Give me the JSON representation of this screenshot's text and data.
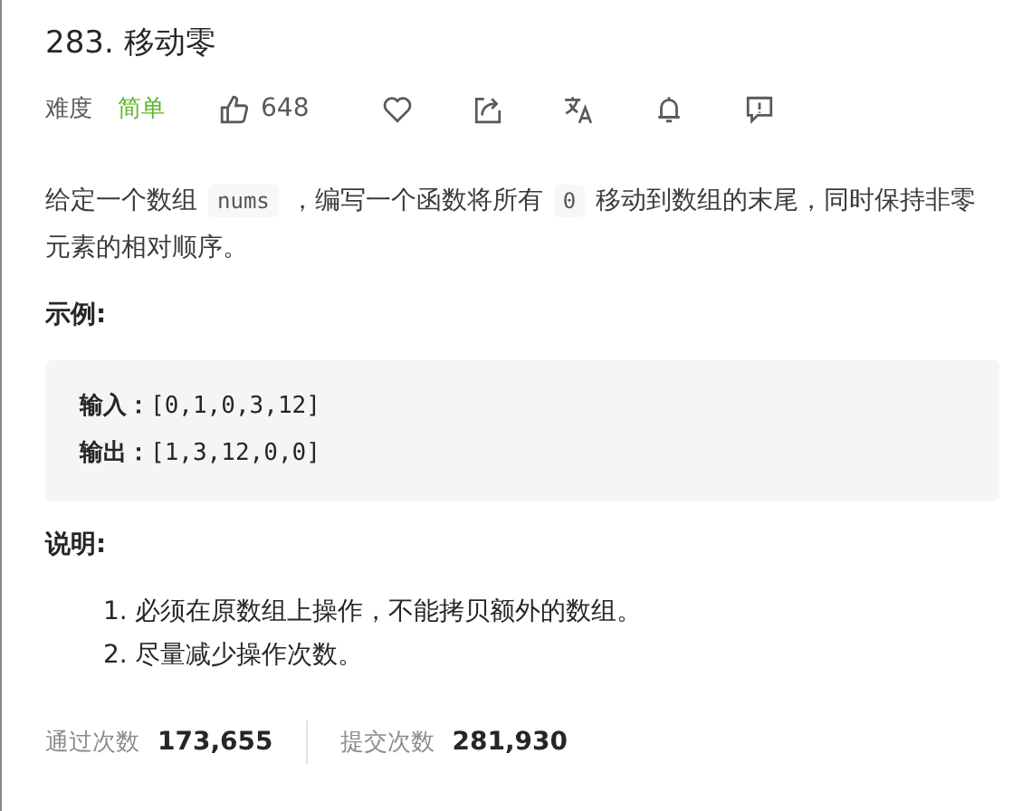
{
  "title": "283. 移动零",
  "difficulty_label": "难度",
  "difficulty": "简单",
  "likes": "648",
  "description": [
    {
      "kind": "text",
      "text": "给定一个数组"
    },
    {
      "kind": "code",
      "text": "nums"
    },
    {
      "kind": "text",
      "text": "，编写一个函数将所有"
    },
    {
      "kind": "code",
      "text": "0"
    },
    {
      "kind": "text",
      "text": "移动到数组的末尾，同时保持非零元素的相对顺序。"
    }
  ],
  "example_heading": "示例:",
  "example": [
    {
      "label": "输入：",
      "value": "[0,1,0,3,12]"
    },
    {
      "label": "输出：",
      "value": "[1,3,12,0,0]"
    }
  ],
  "notes_heading": "说明:",
  "notes": [
    {
      "number": "1.",
      "text": "必须在原数组上操作，不能拷贝额外的数组。"
    },
    {
      "number": "2.",
      "text": "尽量减少操作次数。"
    }
  ],
  "stats": [
    {
      "label": "通过次数",
      "value": "173,655"
    },
    {
      "label": "提交次数",
      "value": "281,930"
    }
  ]
}
